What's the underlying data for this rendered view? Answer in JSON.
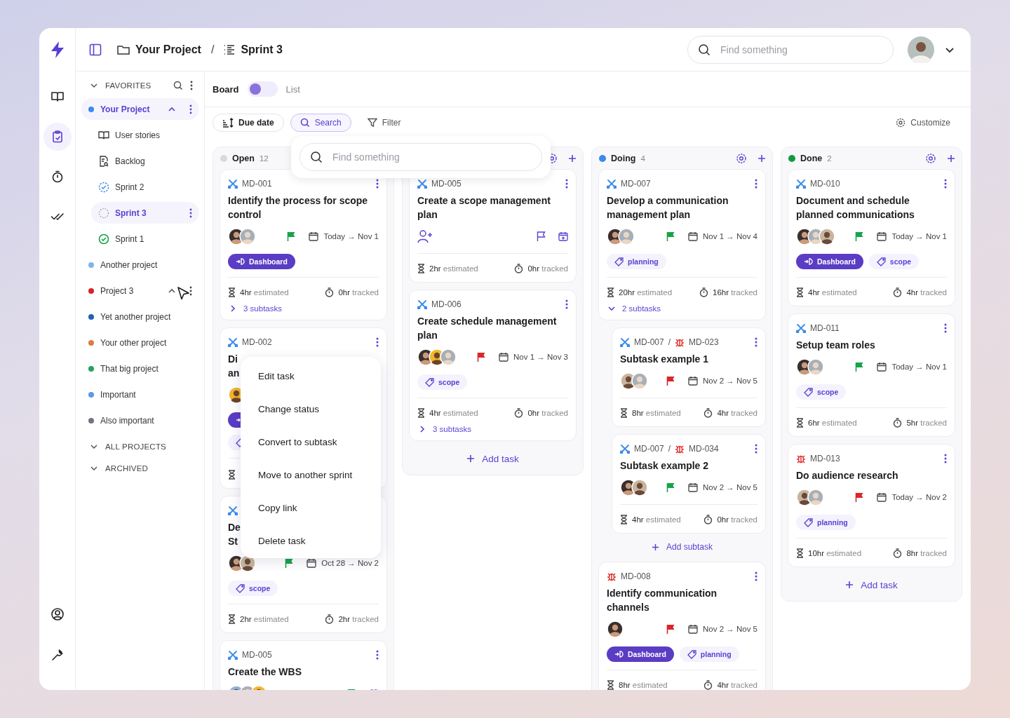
{
  "rail": {
    "items": [
      {
        "kind": "stories",
        "selected": false
      },
      {
        "kind": "tasks",
        "selected": true
      },
      {
        "kind": "timer",
        "selected": false
      },
      {
        "kind": "done",
        "selected": false
      }
    ],
    "bottom": [
      {
        "kind": "account"
      },
      {
        "kind": "tools"
      }
    ]
  },
  "breadcrumb": [
    {
      "kind": "folder",
      "label": "Your Project"
    },
    {
      "kind": "list",
      "label": "Sprint 3"
    }
  ],
  "breadcrumb_separator": "/",
  "search": {
    "placeholder": "Find something"
  },
  "sidebar": {
    "favorites": "FAVORITES",
    "projects": [
      {
        "name": "Your Project",
        "color": "#3b8be8",
        "selected": true,
        "hovered": false,
        "children": [
          {
            "kind": "stories",
            "name": "User stories",
            "selected": false
          },
          {
            "kind": "backlog",
            "name": "Backlog",
            "selected": false
          },
          {
            "kind": "sprint_next",
            "name": "Sprint 2",
            "selected": false
          },
          {
            "kind": "sprint_current",
            "name": "Sprint 3",
            "selected": true
          },
          {
            "kind": "sprint_done",
            "name": "Sprint 1",
            "selected": false
          }
        ]
      },
      {
        "name": "Another project",
        "color": "#7fb3f0",
        "selected": false,
        "hovered": false
      },
      {
        "name": "Project 3",
        "color": "#d6242a",
        "selected": false,
        "hovered": true
      },
      {
        "name": "Yet another project",
        "color": "#1f62b8",
        "selected": false,
        "hovered": false
      },
      {
        "name": "Your other project",
        "color": "#e07a45",
        "selected": false,
        "hovered": false
      },
      {
        "name": "That big project",
        "color": "#23a45a",
        "selected": false,
        "hovered": false
      },
      {
        "name": "Important",
        "color": "#5a9ae8",
        "selected": false,
        "hovered": false
      },
      {
        "name": "Also important",
        "color": "#6f7680",
        "selected": false,
        "hovered": false
      }
    ],
    "sections": [
      "ALL PROJECTS",
      "ARCHIVED"
    ]
  },
  "views": [
    {
      "label": "Board",
      "selected": true
    },
    {
      "label": "List",
      "selected": false
    }
  ],
  "toolbar": {
    "buttons": [
      {
        "kind": "sort",
        "label": "Due date",
        "selected": false
      },
      {
        "kind": "search",
        "label": "Search",
        "selected": true
      },
      {
        "kind": "filter",
        "label": "Filter",
        "selected": false
      }
    ],
    "customize": "Customize"
  },
  "columns": [
    {
      "title": "Open",
      "count": "12",
      "color": "#d9d9dd",
      "cards": [
        {
          "kind": "story",
          "id": "MD-001",
          "title": "Identify the process for scope control",
          "assignees": [
            {
              "kind": "dark"
            },
            {
              "kind": "grey"
            }
          ],
          "flag": {
            "color": "#16a34a"
          },
          "dates": "Today → Nov 1",
          "labels": [
            {
              "kind": "component",
              "label": "Dashboard"
            }
          ],
          "estimate": "**4hr** estimated",
          "tracked": "**0hr** tracked",
          "subtasks": {
            "label": "3 subtasks",
            "expanded": false
          }
        },
        {
          "kind": "story",
          "id": "MD-002",
          "title_lines": [
            "Di",
            "an"
          ],
          "covered": true,
          "assignees": [
            {
              "kind": "yellow"
            }
          ],
          "labels": [
            {
              "kind": "component"
            },
            {
              "kind": "tag"
            }
          ]
        },
        {
          "kind": "story",
          "title_lines": [
            "De",
            "St"
          ],
          "assignees": [
            {
              "kind": "dark"
            },
            {
              "kind": "tan"
            }
          ],
          "flag": {
            "color": "#16a34a"
          },
          "dates": "Oct 28 → Nov 2",
          "labels": [
            {
              "kind": "tag",
              "label": "scope"
            }
          ],
          "estimate": "**2hr** estimated",
          "tracked": "**2hr** tracked"
        },
        {
          "kind": "story",
          "id": "MD-005",
          "title": "Create the WBS",
          "assignees": [
            {
              "kind": "blue"
            },
            {
              "kind": "grey"
            },
            {
              "kind": "yellow"
            }
          ],
          "flag": {
            "color": "#16a34a"
          }
        }
      ]
    },
    {
      "controls": true,
      "cards": [
        {
          "kind": "story",
          "id": "MD-005",
          "title": "Create a scope management plan",
          "estimate": "**2hr** estimated",
          "tracked": "**0hr** tracked"
        },
        {
          "kind": "story",
          "id": "MD-006",
          "title": "Create schedule management plan",
          "assignees": [
            {
              "kind": "dark"
            },
            {
              "kind": "yellow"
            },
            {
              "kind": "grey"
            }
          ],
          "flag": {
            "color": "#d9262c"
          },
          "dates": "Nov 1 → Nov 3",
          "labels": [
            {
              "kind": "tag",
              "label": "scope"
            }
          ],
          "estimate": "**4hr** estimated",
          "tracked": "**0hr** tracked",
          "subtasks": {
            "label": "3 subtasks",
            "expanded": false
          }
        }
      ],
      "add_task": "Add task"
    },
    {
      "title": "Doing",
      "count": "4",
      "color": "#3b8be8",
      "controls": true,
      "cards": [
        {
          "kind": "story",
          "id": "MD-007",
          "title": "Develop a communication management plan",
          "assignees": [
            {
              "kind": "dark"
            },
            {
              "kind": "grey"
            }
          ],
          "flag": {
            "color": "#16a34a"
          },
          "dates": "Nov 1 → Nov 4",
          "labels": [
            {
              "kind": "tag",
              "label": "planning"
            }
          ],
          "estimate": "**20hr** estimated",
          "tracked": "**16hr** tracked",
          "subtasks": {
            "label": "2 subtasks",
            "expanded": true
          },
          "children": [
            {
              "kind": "bug",
              "parent": {
                "kind": "story",
                "id": "MD-007",
                "separator": "/"
              },
              "id": "MD-023",
              "title": "Subtask example 1",
              "assignees": [
                {
                  "kind": "tan"
                },
                {
                  "kind": "grey"
                }
              ],
              "flag": {
                "color": "#d9262c"
              },
              "dates": "Nov 2 → Nov 5",
              "estimate": "**8hr** estimated",
              "tracked": "**4hr** tracked"
            },
            {
              "kind": "bug",
              "parent": {
                "kind": "story",
                "id": "MD-007",
                "separator": "/"
              },
              "id": "MD-034",
              "title": "Subtask example 2",
              "assignees": [
                {
                  "kind": "dark"
                },
                {
                  "kind": "tan"
                }
              ],
              "flag": {
                "color": "#16a34a"
              },
              "dates": "Nov 2 → Nov 5",
              "estimate": "**4hr** estimated",
              "tracked": "**0hr** tracked"
            }
          ],
          "add_subtask": "Add subtask"
        },
        {
          "kind": "bug",
          "id": "MD-008",
          "title": "Identify communication channels",
          "assignees": [
            {
              "kind": "dark"
            }
          ],
          "flag": {
            "color": "#d9262c"
          },
          "dates": "Nov 2 → Nov 5",
          "labels": [
            {
              "kind": "component",
              "label": "Dashboard"
            },
            {
              "kind": "tag",
              "label": "planning"
            }
          ],
          "estimate": "**8hr** estimated",
          "tracked": "**4hr** tracked"
        }
      ]
    },
    {
      "title": "Done",
      "count": "2",
      "color": "#129b3c",
      "controls": true,
      "cards": [
        {
          "kind": "story",
          "id": "MD-010",
          "title": "Document and schedule planned communications",
          "assignees": [
            {
              "kind": "dark"
            },
            {
              "kind": "grey"
            },
            {
              "kind": "tan"
            }
          ],
          "flag": {
            "color": "#16a34a"
          },
          "dates": "Today → Nov 1",
          "labels": [
            {
              "kind": "component",
              "label": "Dashboard"
            },
            {
              "kind": "tag",
              "label": "scope"
            }
          ],
          "estimate": "**4hr** estimated",
          "tracked": "**4hr** tracked"
        },
        {
          "kind": "story",
          "id": "MD-011",
          "title": "Setup team roles",
          "assignees": [
            {
              "kind": "dark"
            },
            {
              "kind": "grey"
            }
          ],
          "flag": {
            "color": "#16a34a"
          },
          "dates": "Today → Nov 1",
          "labels": [
            {
              "kind": "tag",
              "label": "scope"
            }
          ],
          "estimate": "**6hr** estimated",
          "tracked": "**5hr** tracked"
        },
        {
          "kind": "bug",
          "id": "MD-013",
          "title": "Do audience research",
          "assignees": [
            {
              "kind": "tan"
            },
            {
              "kind": "grey"
            }
          ],
          "flag": {
            "color": "#d9262c"
          },
          "dates": "Today → Nov 2",
          "labels": [
            {
              "kind": "tag",
              "label": "planning"
            }
          ],
          "estimate": "**10hr** estimated",
          "tracked": "**8hr** tracked"
        }
      ],
      "add_task": "Add task"
    }
  ],
  "search_popover": {
    "placeholder": "Find something"
  },
  "context_menu": [
    "Edit task",
    "Change status",
    "Convert to subtask",
    "Move to another sprint",
    "Copy link",
    "Delete task"
  ]
}
